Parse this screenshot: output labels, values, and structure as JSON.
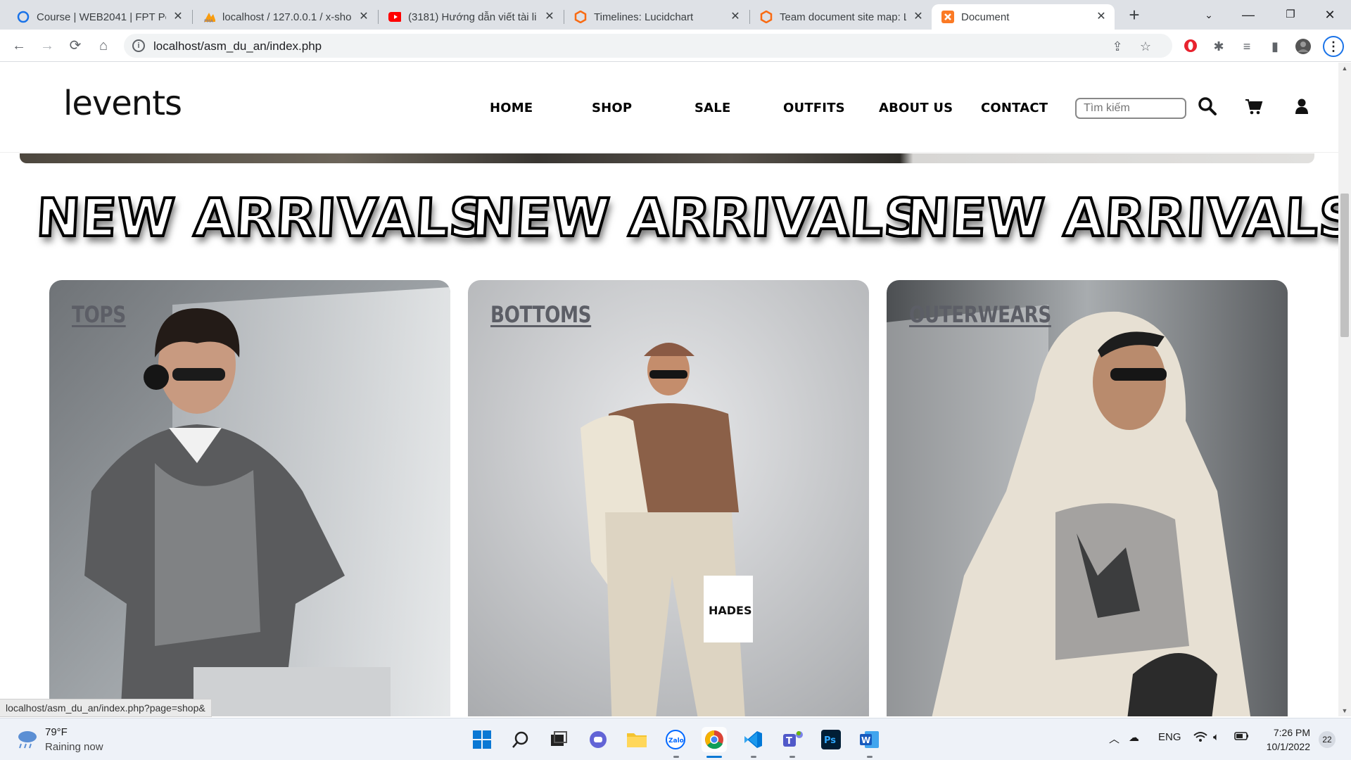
{
  "browser": {
    "tabs": [
      {
        "title": "Course | WEB2041 | FPT Pol",
        "icon": "blue-ring-icon"
      },
      {
        "title": "localhost / 127.0.0.1 / x-sho",
        "icon": "phpmyadmin-icon"
      },
      {
        "title": "(3181) Hướng dẫn viết tài li",
        "icon": "youtube-icon"
      },
      {
        "title": "Timelines: Lucidchart",
        "icon": "lucidchart-icon"
      },
      {
        "title": "Team document site map: L",
        "icon": "lucidchart-icon"
      },
      {
        "title": "Document",
        "icon": "xampp-icon",
        "active": true
      }
    ],
    "address": "localhost/asm_du_an/index.php",
    "status_url": "localhost/asm_du_an/index.php?page=shop&"
  },
  "site": {
    "logo": "levents",
    "nav": [
      "HOME",
      "SHOP",
      "SALE",
      "OUTFITS",
      "ABOUT US",
      "CONTACT"
    ],
    "search_placeholder": "Tìm kiếm",
    "banner_text": [
      "NEW ARRIVALS",
      "NEW ARRIVALS",
      "NEW ARRIVALS"
    ],
    "categories": [
      {
        "label": "TOPS"
      },
      {
        "label": "BOTTOMS"
      },
      {
        "label": "OUTERWEARS"
      }
    ]
  },
  "taskbar": {
    "weather_temp": "79°F",
    "weather_status": "Raining now",
    "language": "ENG",
    "time": "7:26 PM",
    "date": "10/1/2022",
    "notifications": "22"
  }
}
